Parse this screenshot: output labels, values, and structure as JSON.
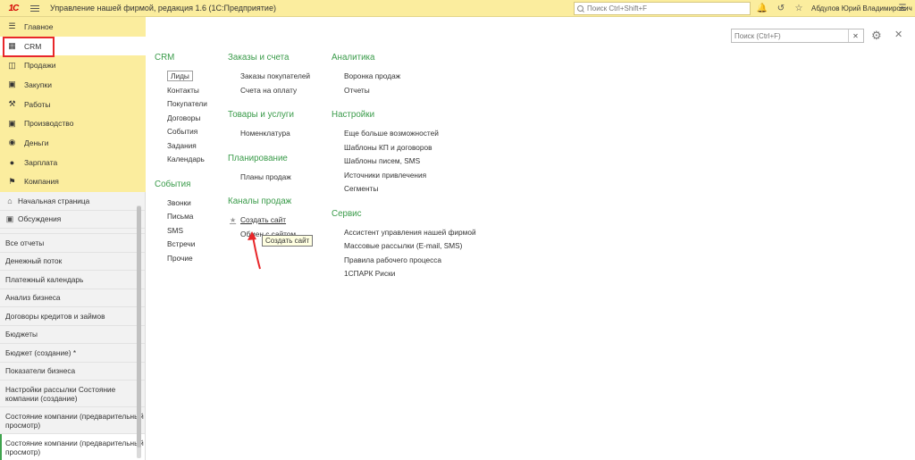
{
  "titlebar": {
    "logo": "1С",
    "title": "Управление нашей фирмой, редакция 1.6  (1С:Предприятие)",
    "search_placeholder": "Поиск Ctrl+Shift+F",
    "user": "Абдулов Юрий Владимирович",
    "icons": [
      "bell-icon",
      "history-icon",
      "star-icon",
      "menu-icon",
      "minimize-icon",
      "close-icon"
    ]
  },
  "sections": [
    {
      "label": "Главное",
      "icon": "menu-icon"
    },
    {
      "label": "CRM",
      "icon": "crm-icon"
    },
    {
      "label": "Продажи",
      "icon": "sales-icon"
    },
    {
      "label": "Закупки",
      "icon": "purchases-icon"
    },
    {
      "label": "Работы",
      "icon": "works-icon"
    },
    {
      "label": "Производство",
      "icon": "factory-icon"
    },
    {
      "label": "Деньги",
      "icon": "money-icon"
    },
    {
      "label": "Зарплата",
      "icon": "salary-icon"
    },
    {
      "label": "Компания",
      "icon": "flag-icon"
    }
  ],
  "nav": {
    "home": "Начальная страница",
    "discussions": "Обсуждения",
    "items": [
      "Все отчеты",
      "Денежный поток",
      "Платежный календарь",
      "Анализ бизнеса",
      "Договоры кредитов и займов",
      "Бюджеты",
      "Бюджет (создание) *",
      "Показатели бизнеса"
    ],
    "two_line": [
      "Настройки рассылки Состояние компании (создание)",
      "Состояние компании (предварительный просмотр)",
      "Состояние компании (предварительный просмотр)"
    ]
  },
  "main": {
    "search_placeholder": "Поиск (Ctrl+F)",
    "crm": {
      "title": "CRM",
      "links": [
        "Лиды",
        "Контакты",
        "Покупатели",
        "Договоры",
        "События",
        "Задания",
        "Календарь"
      ]
    },
    "events": {
      "title": "События",
      "links": [
        "Звонки",
        "Письма",
        "SMS",
        "Встречи",
        "Прочие"
      ]
    },
    "orders": {
      "title": "Заказы и счета",
      "links": [
        "Заказы покупателей",
        "Счета на оплату"
      ]
    },
    "goods": {
      "title": "Товары и услуги",
      "links": [
        "Номенклатура"
      ]
    },
    "planning": {
      "title": "Планирование",
      "links": [
        "Планы продаж"
      ]
    },
    "channels": {
      "title": "Каналы продаж",
      "links": [
        "Создать сайт",
        "Обмен с сайтом"
      ]
    },
    "analytics": {
      "title": "Аналитика",
      "links": [
        "Воронка продаж",
        "Отчеты"
      ]
    },
    "settings": {
      "title": "Настройки",
      "links": [
        "Еще больше возможностей",
        "Шаблоны КП и договоров",
        "Шаблоны писем, SMS",
        "Источники привлечения",
        "Сегменты"
      ]
    },
    "service": {
      "title": "Сервис",
      "links": [
        "Ассистент управления нашей фирмой",
        "Массовые рассылки (E-mail, SMS)",
        "Правила рабочего процесса",
        "1СПАРК Риски"
      ]
    },
    "tooltip": "Создать сайт"
  }
}
